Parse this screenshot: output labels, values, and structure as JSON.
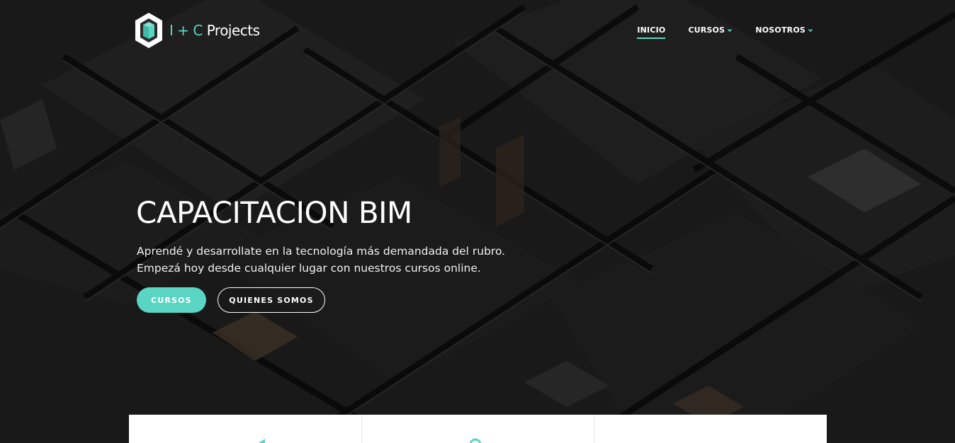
{
  "brand": {
    "logo_icon": "cube-c-logo-icon",
    "prefix": "I + C",
    "name": "Projects",
    "accent_color": "#5bd5c3"
  },
  "nav": {
    "items": [
      {
        "label": "INICIO",
        "active": true,
        "dropdown": false
      },
      {
        "label": "CURSOS",
        "active": false,
        "dropdown": true
      },
      {
        "label": "NOSOTROS",
        "active": false,
        "dropdown": true
      }
    ]
  },
  "hero": {
    "title": "CAPACITACION BIM",
    "subtitle_line1": "Aprendé y desarrollate en la tecnología más demandada del rubro.",
    "subtitle_line2": "Empezá hoy desde cualquier lugar con nuestros cursos online.",
    "primary_button": "CURSOS",
    "secondary_button": "QUIENES SOMOS"
  },
  "cards": [
    {
      "icon": "feature-icon-1"
    },
    {
      "icon": "feature-icon-2"
    },
    {
      "icon": "feature-icon-3"
    }
  ]
}
